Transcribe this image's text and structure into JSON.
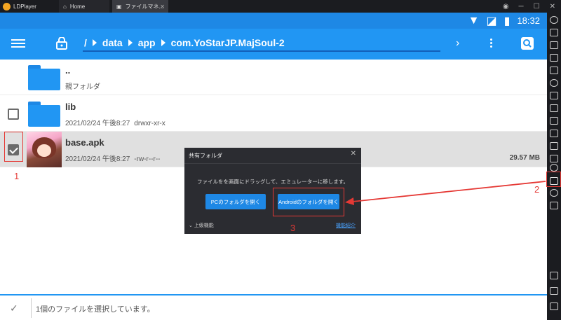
{
  "emulator": {
    "app_name": "LDPlayer",
    "tabs": [
      {
        "label": "Home"
      },
      {
        "label": "ファイルマネ..."
      }
    ],
    "window_controls": [
      "─",
      "☐",
      "✕"
    ]
  },
  "statusbar": {
    "time": "18:32"
  },
  "toolbar": {
    "breadcrumbs": [
      "/",
      "data",
      "app",
      "com.YoStarJP.MajSoul-2"
    ]
  },
  "files": [
    {
      "name": "..",
      "meta": "親フォルダ",
      "type": "folder",
      "checkbox": false
    },
    {
      "name": "lib",
      "date": "2021/02/24 午後8:27",
      "perm": "drwxr-xr-x",
      "type": "folder",
      "checkbox": true,
      "checked": false
    },
    {
      "name": "base.apk",
      "date": "2021/02/24 午後8:27",
      "perm": "-rw-r--r--",
      "size": "29.57 MB",
      "type": "apk",
      "checkbox": true,
      "checked": true
    }
  ],
  "bottombar": {
    "message": "1個のファイルを選択しています。"
  },
  "dialog": {
    "title": "共有フォルダ",
    "description": "ファイルをを画面にドラッグして、エミュレーターに移します。",
    "pc_button": "PCのフォルダを開く",
    "android_button": "Androidのフォルダを開く",
    "advanced": "上级機能",
    "feature_link": "機能紹介"
  },
  "annotations": {
    "n1": "1",
    "n2": "2",
    "n3": "3",
    "color": "#e53935"
  },
  "colors": {
    "primary": "#2196f3",
    "status": "#1e88e5"
  }
}
